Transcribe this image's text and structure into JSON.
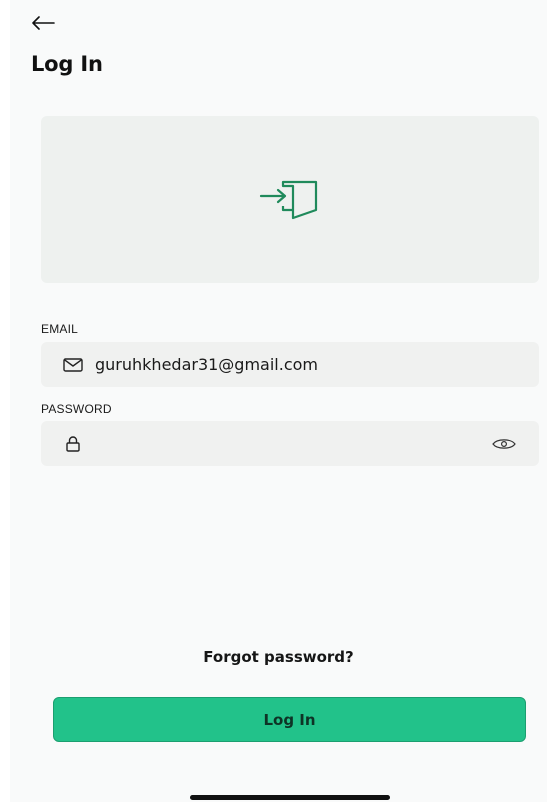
{
  "header": {
    "back_icon": "arrow-left-icon",
    "title": "Log In"
  },
  "hero": {
    "icon": "login-door-icon",
    "accent": "#1f8a5b"
  },
  "form": {
    "email": {
      "label": "EMAIL",
      "icon": "mail-icon",
      "value": "guruhkhedar31@gmail.com"
    },
    "password": {
      "label": "PASSWORD",
      "icon": "lock-icon",
      "value": "",
      "toggle_icon": "eye-icon"
    }
  },
  "forgot_password": "Forgot password?",
  "submit": {
    "label": "Log In",
    "color": "#22c28a"
  }
}
